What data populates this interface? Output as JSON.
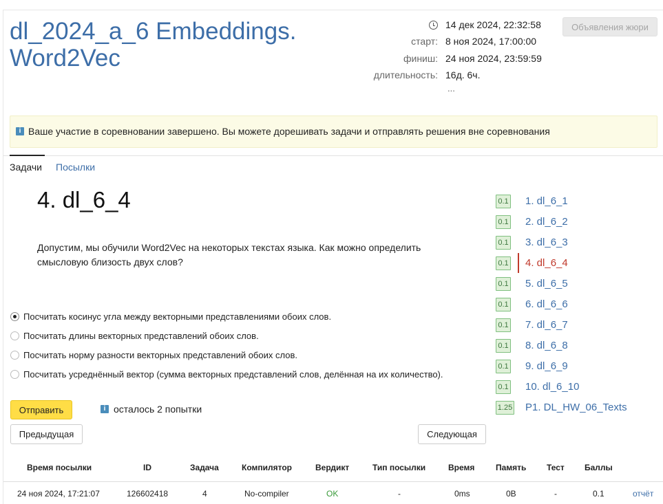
{
  "contest": {
    "title": "dl_2024_a_6 Embeddings. Word2Vec",
    "current_time": "14 дек 2024, 22:32:58",
    "start_label": "старт:",
    "start_value": "8 ноя 2024, 17:00:00",
    "finish_label": "финиш:",
    "finish_value": "24 ноя 2024, 23:59:59",
    "duration_label": "длительность:",
    "duration_value": "16д. 6ч.",
    "more": "...",
    "jury_button": "Объявления жюри"
  },
  "notice": {
    "icon": "info-icon",
    "text": "Ваше участие в соревновании завершено. Вы можете дорешивать задачи и отправлять решения вне соревнования"
  },
  "tabs": [
    {
      "label": "Задачи",
      "active": true
    },
    {
      "label": "Посылки",
      "active": false
    }
  ],
  "problem": {
    "title": "4. dl_6_4",
    "statement": "Допустим, мы обучили Word2Vec на некоторых текстах языка. Как можно определить смысловую близость двух слов?",
    "options": [
      {
        "label": "Посчитать косинус угла между векторными представлениями обоих слов.",
        "checked": true
      },
      {
        "label": "Посчитать длины векторных представлений обоих слов.",
        "checked": false
      },
      {
        "label": "Посчитать норму разности векторных представлений обоих слов.",
        "checked": false
      },
      {
        "label": "Посчитать усреднённый вектор (сумма векторных представлений слов, делённая на их количество).",
        "checked": false
      }
    ],
    "submit_label": "Отправить",
    "attempts_text": "осталось 2 попытки",
    "prev_label": "Предыдущая",
    "next_label": "Следующая"
  },
  "problem_list": [
    {
      "score": "0.1",
      "label": "1. dl_6_1",
      "current": false
    },
    {
      "score": "0.1",
      "label": "2. dl_6_2",
      "current": false
    },
    {
      "score": "0.1",
      "label": "3. dl_6_3",
      "current": false
    },
    {
      "score": "0.1",
      "label": "4. dl_6_4",
      "current": true
    },
    {
      "score": "0.1",
      "label": "5. dl_6_5",
      "current": false
    },
    {
      "score": "0.1",
      "label": "6. dl_6_6",
      "current": false
    },
    {
      "score": "0.1",
      "label": "7. dl_6_7",
      "current": false
    },
    {
      "score": "0.1",
      "label": "8. dl_6_8",
      "current": false
    },
    {
      "score": "0.1",
      "label": "9. dl_6_9",
      "current": false
    },
    {
      "score": "0.1",
      "label": "10. dl_6_10",
      "current": false
    },
    {
      "score": "1.25",
      "label": "P1. DL_HW_06_Texts",
      "current": false
    }
  ],
  "submissions": {
    "headers": [
      "Время посылки",
      "ID",
      "Задача",
      "Компилятор",
      "Вердикт",
      "Тип посылки",
      "Время",
      "Память",
      "Тест",
      "Баллы"
    ],
    "rows": [
      {
        "time": "24 ноя 2024, 17:21:07",
        "id": "126602418",
        "problem": "4",
        "compiler": "No-compiler",
        "verdict": "OK",
        "type": "-",
        "exec_time": "0ms",
        "memory": "0B",
        "test": "-",
        "score": "0.1",
        "report": "отчёт"
      }
    ]
  },
  "colors": {
    "link": "#3d6ea8",
    "title": "#3d6ea8",
    "current": "#c0392b",
    "submit": "#ffdd46",
    "ok": "#3a9a3a",
    "badge_bg": "#dff0d8"
  }
}
